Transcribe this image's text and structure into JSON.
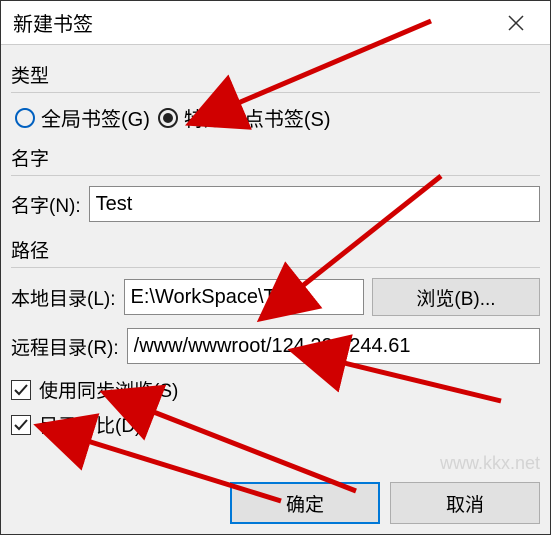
{
  "title": "新建书签",
  "type": {
    "label": "类型",
    "options": {
      "global": "全局书签(G)",
      "site": "特定站点书签(S)"
    },
    "selected": "site"
  },
  "name": {
    "group_label": "名字",
    "field_label": "名字(N):",
    "value": "Test"
  },
  "path": {
    "group_label": "路径",
    "local_label": "本地目录(L):",
    "local_value": "E:\\WorkSpace\\Te",
    "browse_label": "浏览(B)...",
    "remote_label": "远程目录(R):",
    "remote_value": "/www/wwwroot/124.222.244.61",
    "sync_browse": {
      "label": "使用同步浏览(S)",
      "checked": true
    },
    "dir_compare": {
      "label": "目录对比(D)",
      "checked": true
    }
  },
  "buttons": {
    "ok": "确定",
    "cancel": "取消"
  },
  "watermark": "www.kkx.net"
}
